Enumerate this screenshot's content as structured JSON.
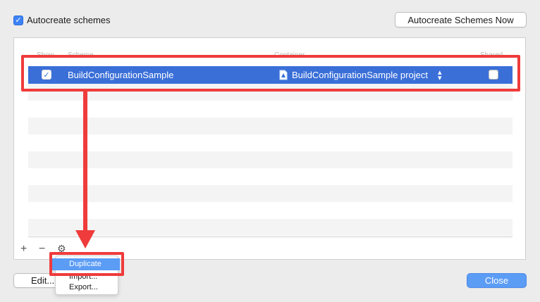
{
  "autocreate": {
    "label": "Autocreate schemes",
    "checked": true
  },
  "autocreate_now_button": "Autocreate Schemes Now",
  "table": {
    "headers": {
      "show": "Show",
      "scheme": "Scheme",
      "container": "Container",
      "shared": "Shared"
    },
    "rows": [
      {
        "show": true,
        "scheme": "BuildConfigurationSample",
        "container": "BuildConfigurationSample project",
        "shared": false
      }
    ]
  },
  "toolbar": {
    "add_icon": "plus-icon",
    "remove_icon": "minus-icon",
    "settings_icon": "gear-icon"
  },
  "menu": {
    "items": [
      "Duplicate",
      "Import...",
      "Export..."
    ],
    "highlighted": "Duplicate"
  },
  "edit_button": "Edit...",
  "close_button": "Close",
  "colors": {
    "accent": "#3a6fd8",
    "annotation": "#ef3b3b",
    "button_primary": "#5b9cf5"
  }
}
